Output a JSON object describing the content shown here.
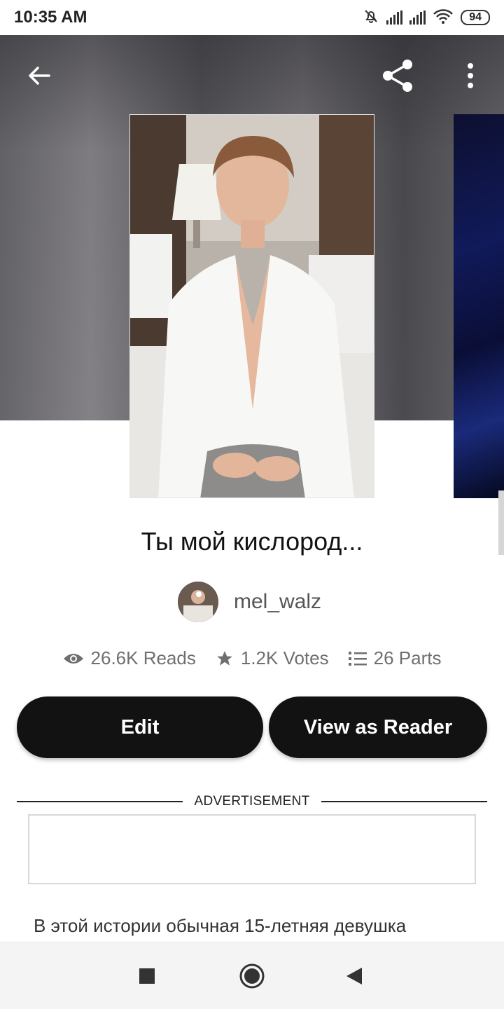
{
  "status_bar": {
    "time": "10:35 AM",
    "battery": "94",
    "icons": [
      "muted-bell-icon",
      "signal-icon",
      "signal-icon",
      "wifi-icon",
      "battery-icon"
    ]
  },
  "header": {
    "back_icon": "arrow-left-icon",
    "share_icon": "share-icon",
    "more_icon": "more-vertical-icon"
  },
  "story": {
    "title": "Ты мой кислород...",
    "author": "mel_walz",
    "stats": {
      "reads": "26.6K Reads",
      "votes": "1.2K Votes",
      "parts": "26 Parts"
    },
    "description": "В этой истории обычная 15-летняя девушка"
  },
  "actions": {
    "edit_label": "Edit",
    "reader_label": "View as Reader"
  },
  "ad": {
    "label": "ADVERTISEMENT"
  },
  "nav": {
    "icons": [
      "square-icon",
      "circle-icon",
      "triangle-back-icon"
    ]
  },
  "colors": {
    "button_bg": "#121212",
    "button_text": "#ffffff",
    "stats_text": "#6f6f6f"
  }
}
